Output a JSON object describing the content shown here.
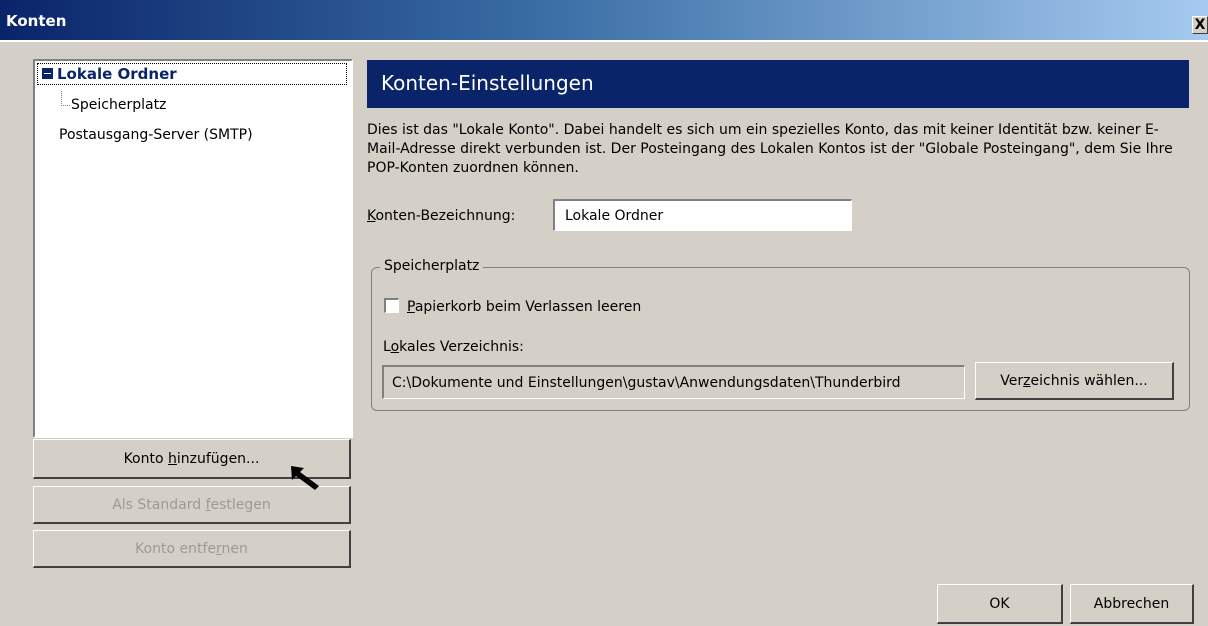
{
  "window": {
    "title": "Konten",
    "close": "X"
  },
  "tree": {
    "items": [
      {
        "label": "Lokale Ordner"
      },
      {
        "label": "Speicherplatz"
      },
      {
        "label": "Postausgang-Server (SMTP)"
      }
    ]
  },
  "left_buttons": {
    "add_pre": "Konto ",
    "add_key": "h",
    "add_post": "inzufügen...",
    "std_pre": "Als Standard ",
    "std_key": "f",
    "std_post": "estlegen",
    "del_pre": "Konto entfe",
    "del_key": "r",
    "del_post": "nen"
  },
  "settings": {
    "header": "Konten-Einstellungen",
    "description": "Dies ist das \"Lokale Konto\". Dabei handelt es sich um ein spezielles Konto, das mit keiner Identität bzw. keiner E-Mail-Adresse direkt verbunden ist. Der Posteingang des Lokalen Kontos ist der \"Globale Posteingang\", dem Sie Ihre POP-Konten zuordnen können.",
    "name_label_key": "K",
    "name_label_rest": "onten-Bezeichnung:",
    "name_value": "Lokale Ordner",
    "group_title": "Speicherplatz",
    "trash_key": "P",
    "trash_rest": "apierkorb beim Verlassen leeren",
    "trash_checked": false,
    "dir_label_pre": "L",
    "dir_label_key": "o",
    "dir_label_post": "kales Verzeichnis:",
    "dir_value": "C:\\Dokumente und Einstellungen\\gustav\\Anwendungsdaten\\Thunderbird",
    "dir_btn_pre": "Ver",
    "dir_btn_key": "z",
    "dir_btn_post": "eichnis wählen..."
  },
  "footer": {
    "ok": "OK",
    "cancel": "Abbrechen"
  }
}
